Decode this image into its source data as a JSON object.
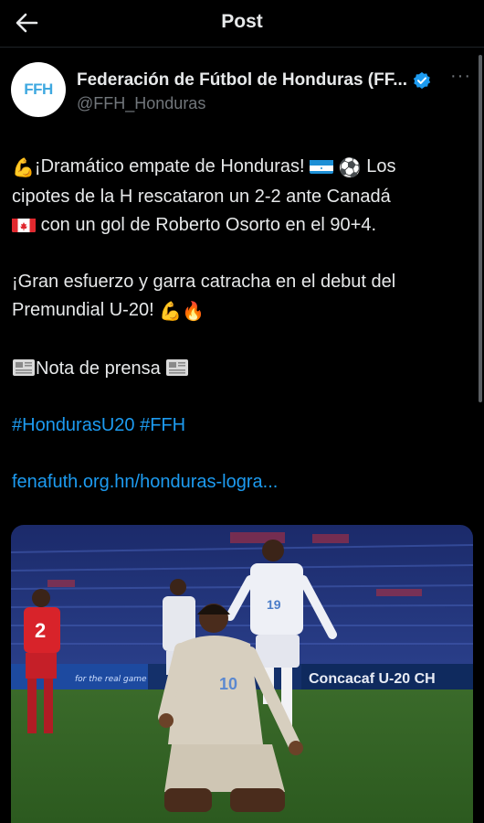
{
  "header": {
    "title": "Post",
    "back_icon": "arrow-left-icon"
  },
  "post": {
    "author": {
      "avatar_text": "FFH",
      "display_name": "Federación de Fútbol de Honduras (FF...",
      "handle": "@FFH_Honduras",
      "verified": true
    },
    "more_label": "···",
    "text": {
      "line1a": "¡Dramático empate de Honduras!",
      "line1b": "Los",
      "line2": "cipotes de la H rescataron un 2-2 ante Canadá",
      "line3": "con un gol de Roberto Osorto en el 90+4.",
      "line4": "¡Gran esfuerzo y garra catracha en el debut del",
      "line5": "Premundial U-20!",
      "press_note": "Nota de prensa",
      "hashtags": "#HondurasU20 #FFH",
      "link": "fenafuth.org.hn/honduras-logra..."
    },
    "media": {
      "banner_text": "Concacaf U-20 CH",
      "banner_small": "for the real game",
      "jersey_red": "2",
      "jersey_white": "19",
      "jersey_front": "10"
    }
  },
  "colors": {
    "background": "#000000",
    "text": "#e7e9ea",
    "secondary": "#71767b",
    "link": "#1d9bf0",
    "verified": "#1d9bf0"
  }
}
